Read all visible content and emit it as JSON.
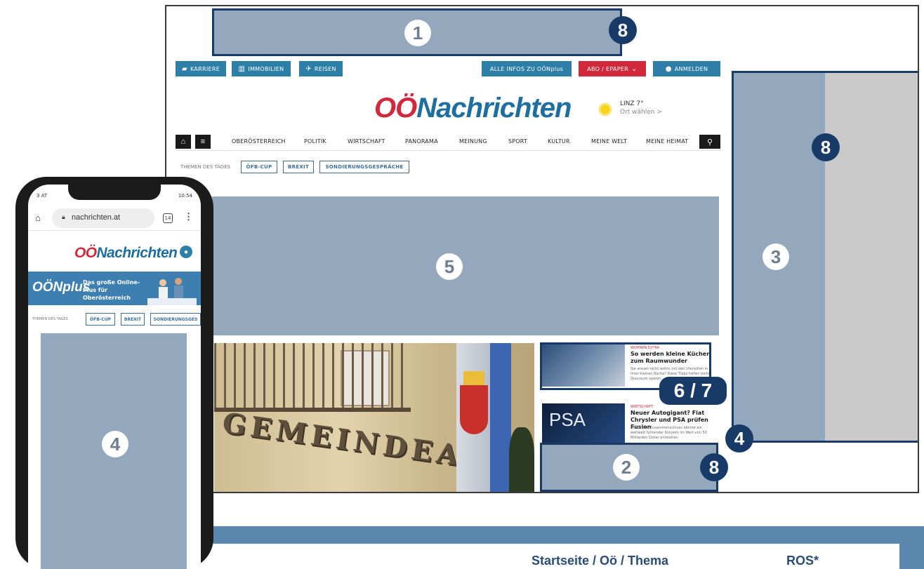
{
  "desktop": {
    "util_bar": {
      "karriere": "KARRIERE",
      "immobilien": "IMMOBILIEN",
      "reisen": "REISEN",
      "alle_infos": "ALLE INFOS ZU OÖNplus",
      "abo": "ABO / EPAPER",
      "anmelden": "ANMELDEN"
    },
    "logo": {
      "part1": "OÖ",
      "part2": "Nachrichten"
    },
    "weather": {
      "city": "LINZ 7°",
      "link": "Ort wählen >"
    },
    "nav": [
      "OBERÖSTERREICH",
      "POLITIK",
      "WIRTSCHAFT",
      "PANORAMA",
      "MEINUNG",
      "SPORT",
      "KULTUR",
      "MEINE WELT",
      "MEINE HEIMAT"
    ],
    "themen_label": "THEMEN DES TAGES",
    "tags": [
      "ÖFB-CUP",
      "BREXIT",
      "SONDIERUNGSGESPRÄCHE"
    ],
    "photo_text": "GEMEINDEAMT",
    "teasers": [
      {
        "category": "WOHNEN EXTRA",
        "headline": "So werden kleine Küchen zum Raumwunder",
        "text": "Sie wissen nicht wohin mit den Utensilien in Ihrer kleinen Küche? Diese Tipps helfen beim Stauraum sparen."
      },
      {
        "category": "WIRTSCHAFT",
        "headline": "Neuer Autogigant? Fiat Chrysler und PSA prüfen Fusion",
        "text": "Durch den Zusammenschluss könnte ein weltweit führender Konzern im Wert von 50 Milliarden Dollar entstehen."
      }
    ],
    "teaser_image_text": "PSA"
  },
  "ad_slots": {
    "slot1": "1",
    "slot2": "2",
    "slot3": "3",
    "slot4": "4",
    "slot5": "5",
    "slot67": "6 / 7",
    "badge8": "8",
    "mobile_slot": "4"
  },
  "phone": {
    "status_left": "3 AT",
    "status_right": "10:54",
    "url": "nachrichten.at",
    "tab_count": "14",
    "logo": {
      "part1": "OÖ",
      "part2": "Nachrichten"
    },
    "banner_logo": "OÖNplus",
    "banner_text": "Das große Online-Plus für Oberösterreich",
    "themen_label": "THEMEN DES TAGES",
    "tags": [
      "ÖFB-CUP",
      "BREXIT",
      "SONDIERUNGSGES"
    ]
  },
  "table": {
    "col1": "Startseite / Oö / Thema",
    "col2": "ROS*"
  },
  "colors": {
    "ad_fill": "#93a8bd",
    "ad_border": "#173a66",
    "brand_red": "#d2283c",
    "brand_blue": "#1e6fa0",
    "button_blue": "#2e7fa8",
    "band": "#5a88ae"
  }
}
